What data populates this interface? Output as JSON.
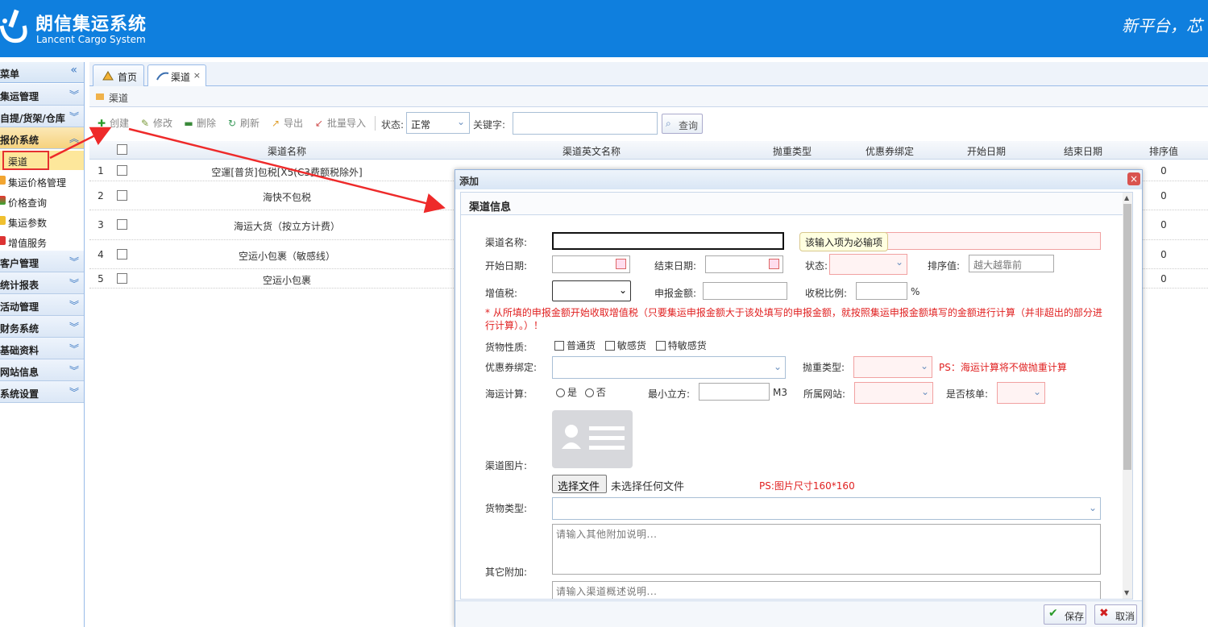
{
  "header": {
    "title": "朗信集运系统",
    "subtitle": "Lancent Cargo System",
    "slogan": "新平台，芯"
  },
  "sidebar": {
    "header": "菜单",
    "groups": [
      {
        "label": "集运管理"
      },
      {
        "label": "自提/货架/仓库"
      },
      {
        "label": "报价系统"
      },
      {
        "label": "客户管理"
      },
      {
        "label": "统计报表"
      },
      {
        "label": "活动管理"
      },
      {
        "label": "财务系统"
      },
      {
        "label": "基础资料"
      },
      {
        "label": "网站信息"
      },
      {
        "label": "系统设置"
      }
    ],
    "items": [
      {
        "label": "渠道"
      },
      {
        "label": "集运价格管理"
      },
      {
        "label": "价格查询"
      },
      {
        "label": "集运参数"
      },
      {
        "label": "增值服务"
      }
    ]
  },
  "tabs": [
    {
      "label": "首页"
    },
    {
      "label": "渠道"
    }
  ],
  "panel": {
    "title": "渠道"
  },
  "toolbar": {
    "create": "创建",
    "edit": "修改",
    "delete": "删除",
    "refresh": "刷新",
    "export": "导出",
    "import": "批量导入",
    "status_label": "状态:",
    "status_value": "正常",
    "keyword_label": "关键字:",
    "search": "查询"
  },
  "grid": {
    "columns": [
      "渠道名称",
      "渠道英文名称",
      "抛重类型",
      "优惠券绑定",
      "开始日期",
      "结束日期",
      "排序值"
    ],
    "rows": [
      {
        "no": "1",
        "name": "空運[普货]包税[X5(C3费额税除外]",
        "sort": "0"
      },
      {
        "no": "2",
        "name": "海快不包税",
        "sort": "0"
      },
      {
        "no": "3",
        "name": "海运大货（按立方计费）",
        "sort": "0"
      },
      {
        "no": "4",
        "name": "空运小包裹（敏感线）",
        "sort": "0"
      },
      {
        "no": "5",
        "name": "空运小包裹",
        "sort": "0"
      }
    ]
  },
  "dialog": {
    "title": "添加",
    "section": "渠道信息",
    "labels": {
      "name": "渠道名称:",
      "start": "开始日期:",
      "end": "结束日期:",
      "status": "状态:",
      "sort": "排序值:",
      "vat": "增值税:",
      "declare": "申报金额:",
      "tax_ratio": "收税比例:",
      "goods_nature": "货物性质:",
      "coupon": "优惠券绑定:",
      "weight_type": "抛重类型:",
      "sea_calc": "海运计算:",
      "min_cbm": "最小立方:",
      "site": "所属网站:",
      "check": "是否核单:",
      "image": "渠道图片:",
      "goods_type": "货物类型:",
      "other": "其它附加:"
    },
    "tooltip": "该输入项为必输项",
    "sort_placeholder": "越大越靠前",
    "percent": "%",
    "unit_m3": "M3",
    "vat_note": "* 从所填的申报金额开始收取增值税（只要集运申报金额大于该处填写的申报金额，就按照集运申报金额填写的金额进行计算（并非超出的部分进行计算）。）！",
    "goods_options": [
      "普通货",
      "敏感货",
      "特敏感货"
    ],
    "sea_options": [
      "是",
      "否"
    ],
    "weight_note": "PS：海运计算将不做抛重计算",
    "file_button": "选择文件",
    "file_none": "未选择任何文件",
    "image_note": "PS:图片尺寸160*160",
    "other_placeholder": "请输入其他附加说明...",
    "desc_placeholder": "请输入渠道概述说明...",
    "save": "保存",
    "cancel": "取消"
  },
  "colors": {
    "header_bg": "#0f7fde",
    "accent_red": "#e02020",
    "active_menu": "#fde79b"
  }
}
